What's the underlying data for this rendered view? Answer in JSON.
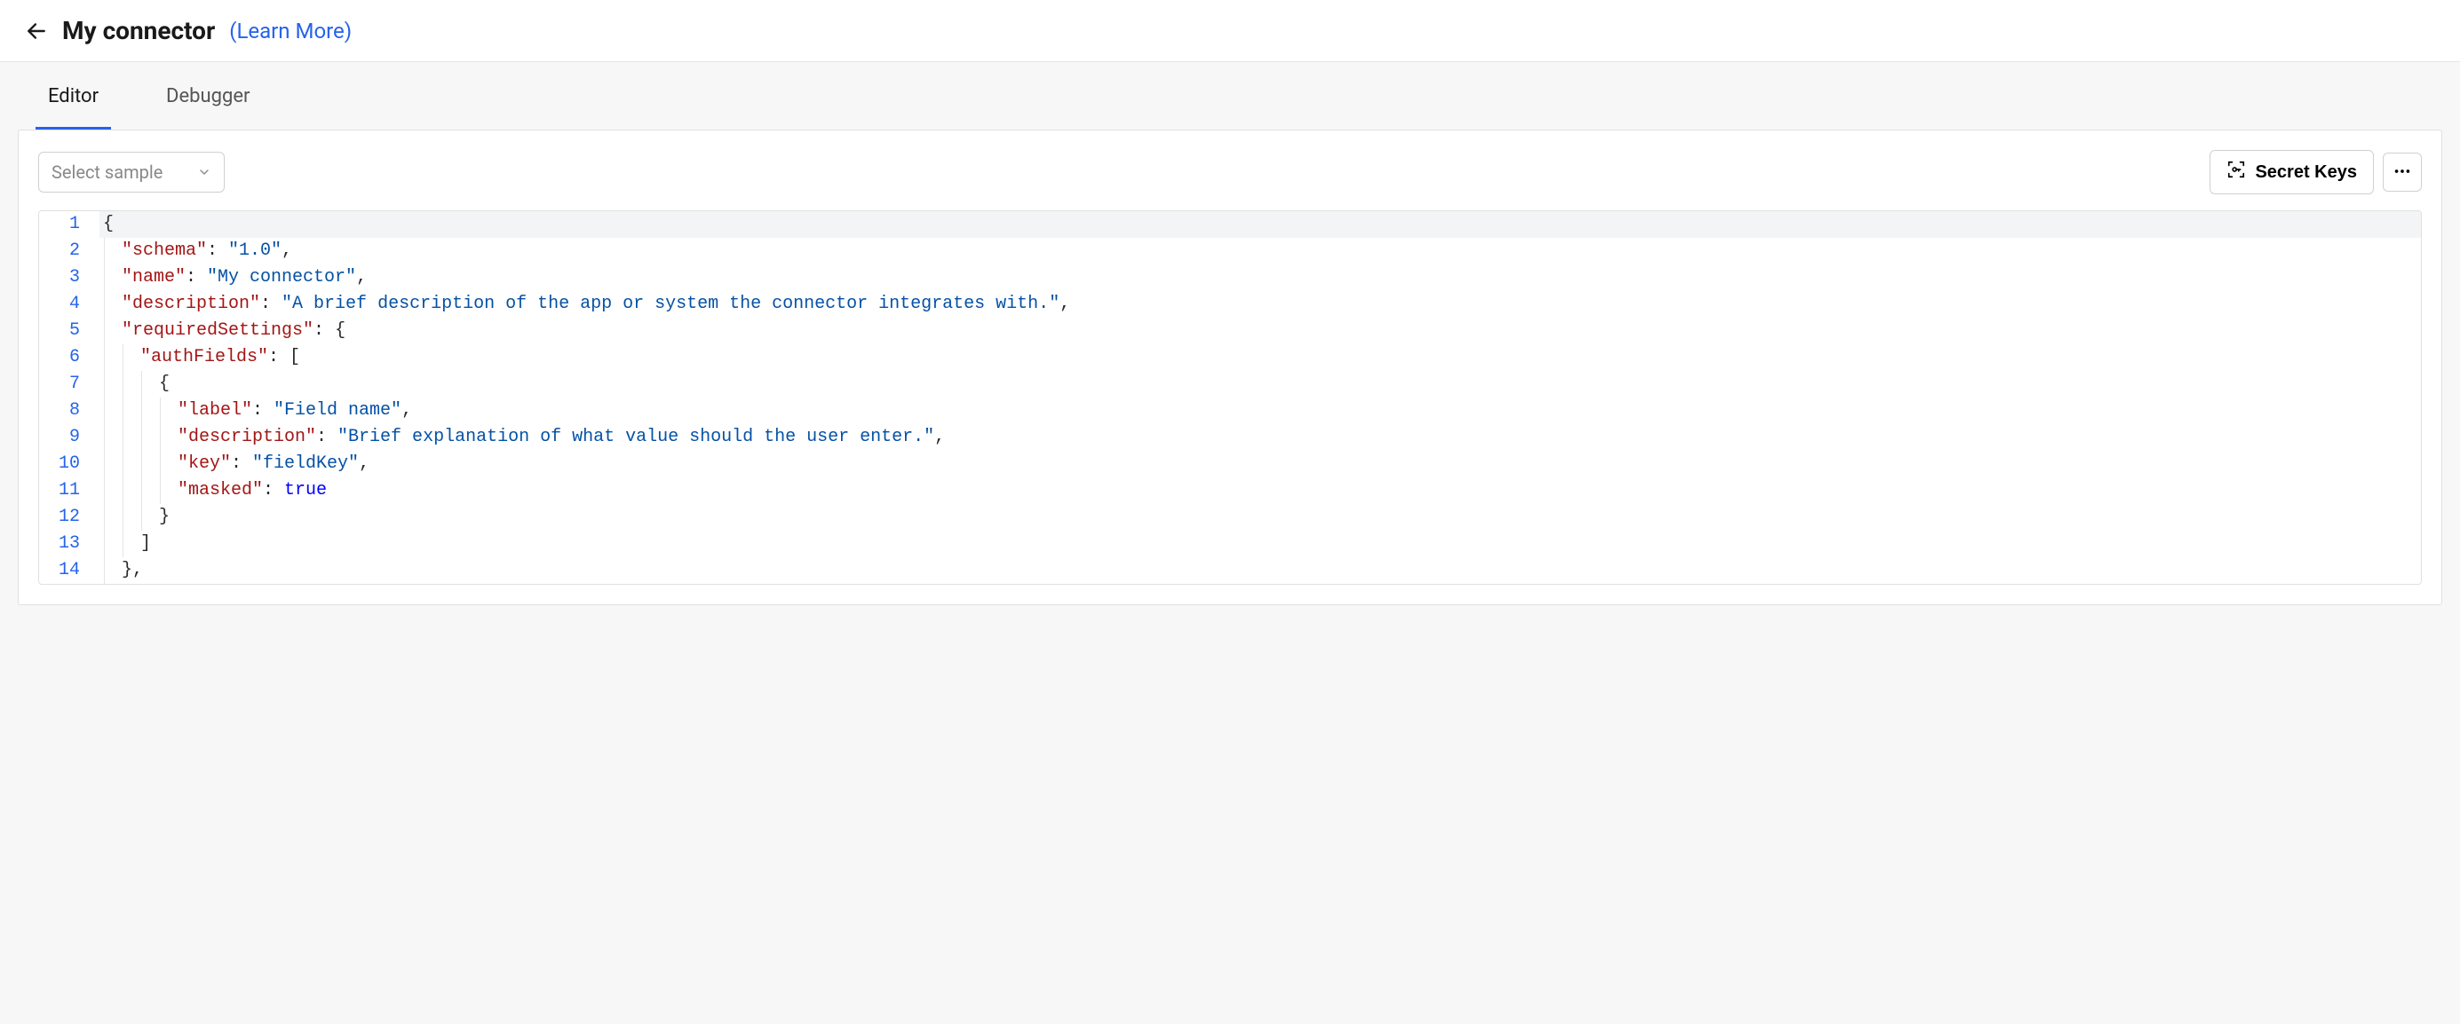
{
  "header": {
    "title": "My connector",
    "learn_more_label": "(Learn More)"
  },
  "tabs": {
    "editor_label": "Editor",
    "debugger_label": "Debugger",
    "active": "editor"
  },
  "toolbar": {
    "select_sample_placeholder": "Select sample",
    "secret_keys_label": "Secret Keys"
  },
  "code": {
    "lines": [
      {
        "num": "1",
        "tokens": [
          {
            "t": "brace",
            "v": "{"
          }
        ]
      },
      {
        "num": "2",
        "indent": 1,
        "tokens": [
          {
            "t": "key",
            "v": "\"schema\""
          },
          {
            "t": "punc",
            "v": ": "
          },
          {
            "t": "str",
            "v": "\"1.0\""
          },
          {
            "t": "punc",
            "v": ","
          }
        ]
      },
      {
        "num": "3",
        "indent": 1,
        "tokens": [
          {
            "t": "key",
            "v": "\"name\""
          },
          {
            "t": "punc",
            "v": ": "
          },
          {
            "t": "str",
            "v": "\"My connector\""
          },
          {
            "t": "punc",
            "v": ","
          }
        ]
      },
      {
        "num": "4",
        "indent": 1,
        "tokens": [
          {
            "t": "key",
            "v": "\"description\""
          },
          {
            "t": "punc",
            "v": ": "
          },
          {
            "t": "str",
            "v": "\"A brief description of the app or system the connector integrates with.\""
          },
          {
            "t": "punc",
            "v": ","
          }
        ]
      },
      {
        "num": "5",
        "indent": 1,
        "tokens": [
          {
            "t": "key",
            "v": "\"requiredSettings\""
          },
          {
            "t": "punc",
            "v": ": "
          },
          {
            "t": "brace",
            "v": "{"
          }
        ]
      },
      {
        "num": "6",
        "indent": 2,
        "tokens": [
          {
            "t": "key",
            "v": "\"authFields\""
          },
          {
            "t": "punc",
            "v": ": "
          },
          {
            "t": "brace",
            "v": "["
          }
        ]
      },
      {
        "num": "7",
        "indent": 3,
        "tokens": [
          {
            "t": "brace",
            "v": "{"
          }
        ]
      },
      {
        "num": "8",
        "indent": 4,
        "tokens": [
          {
            "t": "key",
            "v": "\"label\""
          },
          {
            "t": "punc",
            "v": ": "
          },
          {
            "t": "str",
            "v": "\"Field name\""
          },
          {
            "t": "punc",
            "v": ","
          }
        ]
      },
      {
        "num": "9",
        "indent": 4,
        "tokens": [
          {
            "t": "key",
            "v": "\"description\""
          },
          {
            "t": "punc",
            "v": ": "
          },
          {
            "t": "str",
            "v": "\"Brief explanation of what value should the user enter.\""
          },
          {
            "t": "punc",
            "v": ","
          }
        ]
      },
      {
        "num": "10",
        "indent": 4,
        "tokens": [
          {
            "t": "key",
            "v": "\"key\""
          },
          {
            "t": "punc",
            "v": ": "
          },
          {
            "t": "str",
            "v": "\"fieldKey\""
          },
          {
            "t": "punc",
            "v": ","
          }
        ]
      },
      {
        "num": "11",
        "indent": 4,
        "tokens": [
          {
            "t": "key",
            "v": "\"masked\""
          },
          {
            "t": "punc",
            "v": ": "
          },
          {
            "t": "bool",
            "v": "true"
          }
        ]
      },
      {
        "num": "12",
        "indent": 3,
        "tokens": [
          {
            "t": "brace",
            "v": "}"
          }
        ]
      },
      {
        "num": "13",
        "indent": 2,
        "tokens": [
          {
            "t": "brace",
            "v": "]"
          }
        ]
      },
      {
        "num": "14",
        "indent": 1,
        "tokens": [
          {
            "t": "brace",
            "v": "}"
          },
          {
            "t": "punc",
            "v": ","
          }
        ]
      }
    ]
  }
}
